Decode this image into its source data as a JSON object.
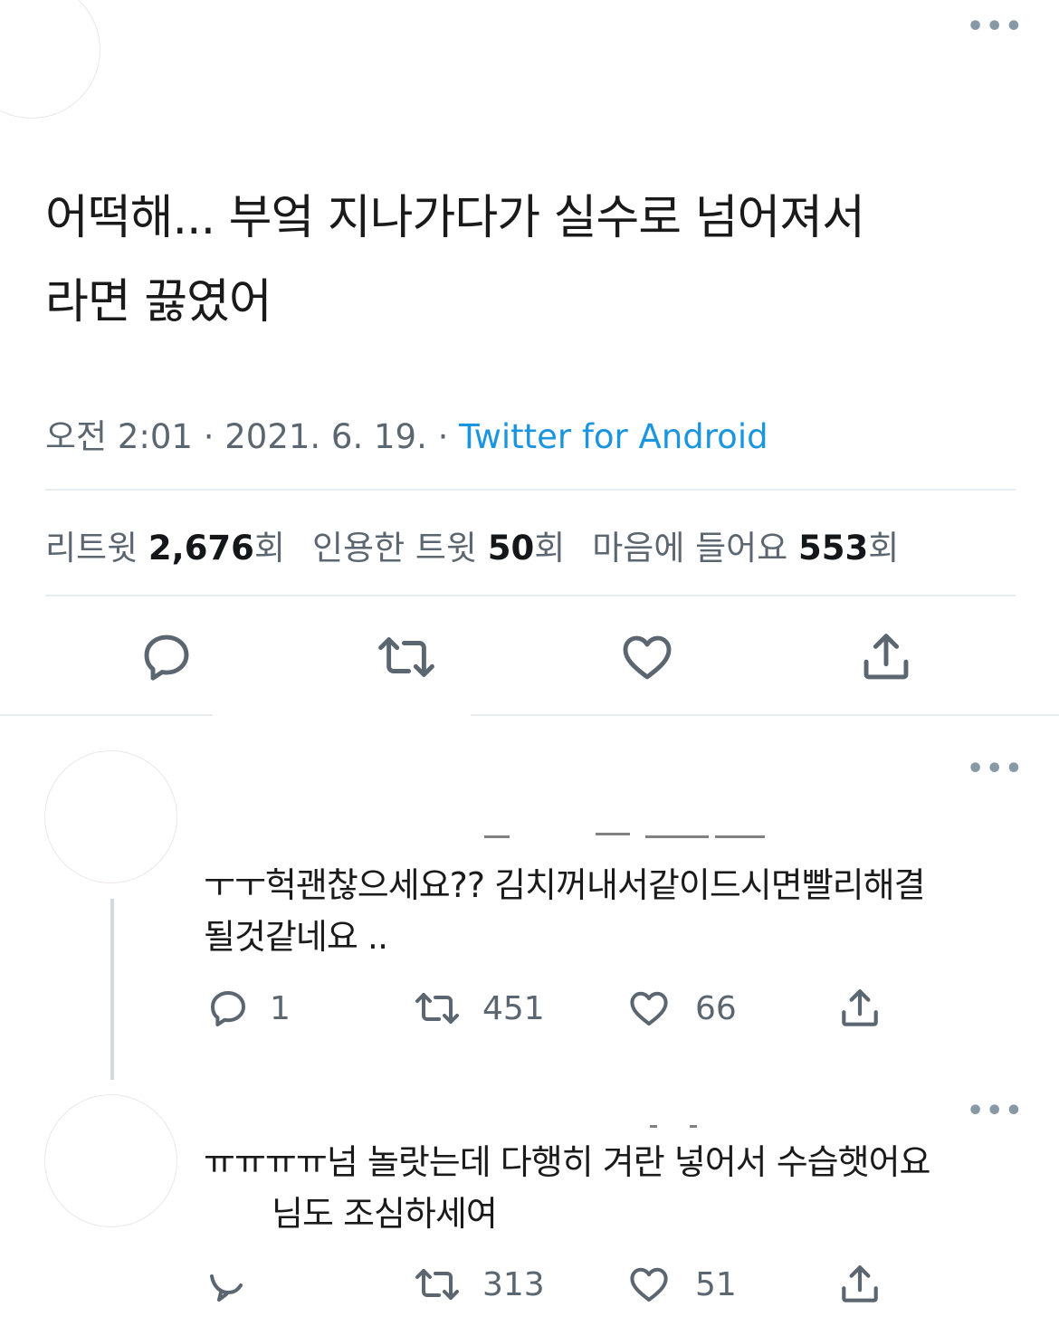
{
  "tweet": {
    "text_line1": "어떡해... 부엌 지나가다가 실수로 넘어져서",
    "text_line2": "라면 끓였어",
    "time": "오전 2:01",
    "sep": " · ",
    "date": "2021. 6. 19.",
    "source": "Twitter for Android",
    "stats": {
      "retweets_label": "리트윗",
      "retweets_value": "2,676",
      "retweets_unit": "회",
      "quotes_label": "인용한 트윗",
      "quotes_value": "50",
      "quotes_unit": "회",
      "likes_label": "마음에 들어요",
      "likes_value": "553",
      "likes_unit": "회"
    },
    "actions": [
      "reply-icon",
      "retweet-icon",
      "like-icon",
      "share-icon"
    ]
  },
  "replies": [
    {
      "text_line1": "ㅜㅜ헉괜찮으세요?? 김치꺼내서같이드시면빨리해결",
      "text_line2": "될것같네요 ..",
      "reply_count": "1",
      "retweet_count": "451",
      "like_count": "66"
    },
    {
      "text_line1": "ㅠㅠㅠㅠ넘 놀랏는데 다행히 겨란 넣어서 수습햇어요",
      "text_line2": "님도 조심하세여",
      "retweet_count": "313",
      "like_count": "51"
    }
  ],
  "colors": {
    "accent": "#1b95e0",
    "muted": "#5b6670",
    "icon": "#5b6670",
    "divider": "#e6ecf0"
  }
}
